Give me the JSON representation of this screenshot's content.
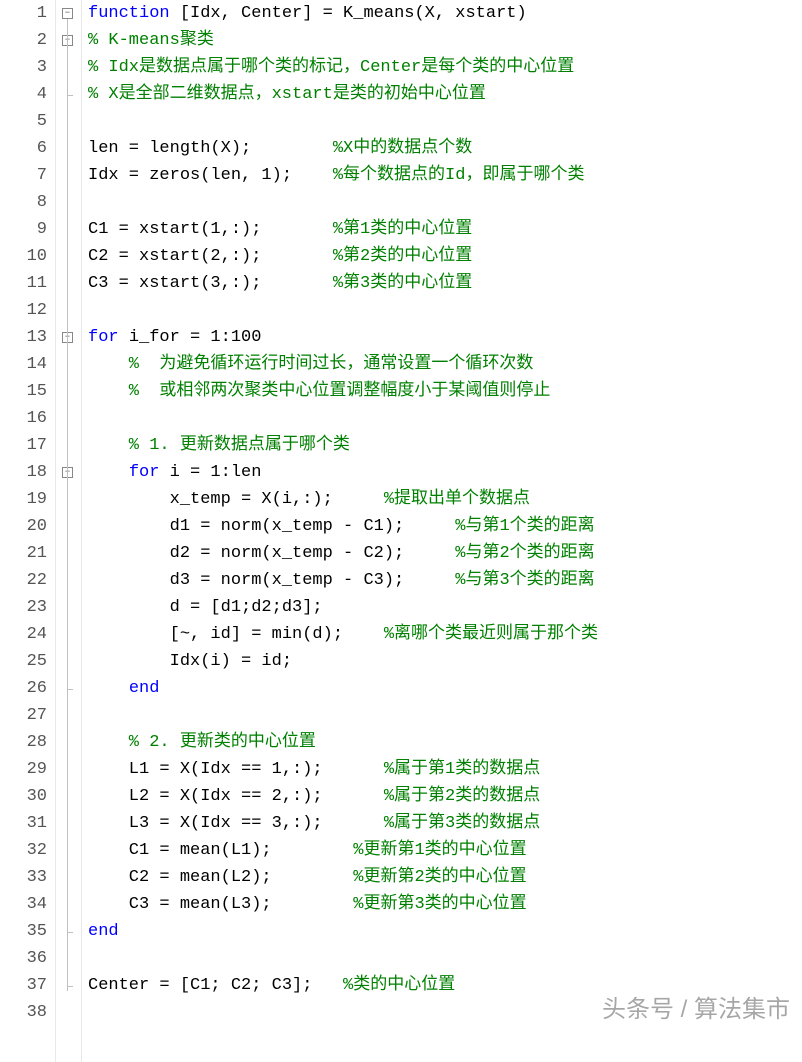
{
  "line_height": 27,
  "lines": [
    {
      "n": "1",
      "tokens": [
        {
          "c": "kw",
          "t": "function "
        },
        {
          "c": "txt",
          "t": "[Idx, Center] = K_means(X, xstart)"
        }
      ]
    },
    {
      "n": "2",
      "tokens": [
        {
          "c": "cm",
          "t": "% K-means聚类"
        }
      ]
    },
    {
      "n": "3",
      "tokens": [
        {
          "c": "cm",
          "t": "% Idx是数据点属于哪个类的标记，Center是每个类的中心位置"
        }
      ]
    },
    {
      "n": "4",
      "tokens": [
        {
          "c": "cm",
          "t": "% X是全部二维数据点，xstart是类的初始中心位置"
        }
      ]
    },
    {
      "n": "5",
      "tokens": []
    },
    {
      "n": "6",
      "tokens": [
        {
          "c": "txt",
          "t": "len = length(X);        "
        },
        {
          "c": "cm",
          "t": "%X中的数据点个数"
        }
      ]
    },
    {
      "n": "7",
      "tokens": [
        {
          "c": "txt",
          "t": "Idx = zeros(len, 1);    "
        },
        {
          "c": "cm",
          "t": "%每个数据点的Id，即属于哪个类"
        }
      ]
    },
    {
      "n": "8",
      "tokens": []
    },
    {
      "n": "9",
      "tokens": [
        {
          "c": "txt",
          "t": "C1 = xstart(1,:);       "
        },
        {
          "c": "cm",
          "t": "%第1类的中心位置"
        }
      ]
    },
    {
      "n": "10",
      "tokens": [
        {
          "c": "txt",
          "t": "C2 = xstart(2,:);       "
        },
        {
          "c": "cm",
          "t": "%第2类的中心位置"
        }
      ]
    },
    {
      "n": "11",
      "tokens": [
        {
          "c": "txt",
          "t": "C3 = xstart(3,:);       "
        },
        {
          "c": "cm",
          "t": "%第3类的中心位置"
        }
      ]
    },
    {
      "n": "12",
      "tokens": []
    },
    {
      "n": "13",
      "tokens": [
        {
          "c": "kw",
          "t": "for "
        },
        {
          "c": "txt",
          "t": "i_for = 1:100"
        }
      ]
    },
    {
      "n": "14",
      "tokens": [
        {
          "c": "cm",
          "t": "    %  为避免循环运行时间过长，通常设置一个循环次数"
        }
      ]
    },
    {
      "n": "15",
      "tokens": [
        {
          "c": "cm",
          "t": "    %  或相邻两次聚类中心位置调整幅度小于某阈值则停止"
        }
      ]
    },
    {
      "n": "16",
      "tokens": []
    },
    {
      "n": "17",
      "tokens": [
        {
          "c": "cm",
          "t": "    % 1. 更新数据点属于哪个类"
        }
      ]
    },
    {
      "n": "18",
      "tokens": [
        {
          "c": "txt",
          "t": "    "
        },
        {
          "c": "kw",
          "t": "for "
        },
        {
          "c": "txt",
          "t": "i = 1:len"
        }
      ]
    },
    {
      "n": "19",
      "tokens": [
        {
          "c": "txt",
          "t": "        x_temp = X(i,:);     "
        },
        {
          "c": "cm",
          "t": "%提取出单个数据点"
        }
      ]
    },
    {
      "n": "20",
      "tokens": [
        {
          "c": "txt",
          "t": "        d1 = norm(x_temp - C1);     "
        },
        {
          "c": "cm",
          "t": "%与第1个类的距离"
        }
      ]
    },
    {
      "n": "21",
      "tokens": [
        {
          "c": "txt",
          "t": "        d2 = norm(x_temp - C2);     "
        },
        {
          "c": "cm",
          "t": "%与第2个类的距离"
        }
      ]
    },
    {
      "n": "22",
      "tokens": [
        {
          "c": "txt",
          "t": "        d3 = norm(x_temp - C3);     "
        },
        {
          "c": "cm",
          "t": "%与第3个类的距离"
        }
      ]
    },
    {
      "n": "23",
      "tokens": [
        {
          "c": "txt",
          "t": "        d = [d1;d2;d3];"
        }
      ]
    },
    {
      "n": "24",
      "tokens": [
        {
          "c": "txt",
          "t": "        [~, id] = min(d);    "
        },
        {
          "c": "cm",
          "t": "%离哪个类最近则属于那个类"
        }
      ]
    },
    {
      "n": "25",
      "tokens": [
        {
          "c": "txt",
          "t": "        Idx(i) = id;"
        }
      ]
    },
    {
      "n": "26",
      "tokens": [
        {
          "c": "txt",
          "t": "    "
        },
        {
          "c": "kw",
          "t": "end"
        }
      ]
    },
    {
      "n": "27",
      "tokens": []
    },
    {
      "n": "28",
      "tokens": [
        {
          "c": "cm",
          "t": "    % 2. 更新类的中心位置"
        }
      ]
    },
    {
      "n": "29",
      "tokens": [
        {
          "c": "txt",
          "t": "    L1 = X(Idx == 1,:);      "
        },
        {
          "c": "cm",
          "t": "%属于第1类的数据点"
        }
      ]
    },
    {
      "n": "30",
      "tokens": [
        {
          "c": "txt",
          "t": "    L2 = X(Idx == 2,:);      "
        },
        {
          "c": "cm",
          "t": "%属于第2类的数据点"
        }
      ]
    },
    {
      "n": "31",
      "tokens": [
        {
          "c": "txt",
          "t": "    L3 = X(Idx == 3,:);      "
        },
        {
          "c": "cm",
          "t": "%属于第3类的数据点"
        }
      ]
    },
    {
      "n": "32",
      "tokens": [
        {
          "c": "txt",
          "t": "    C1 = mean(L1);        "
        },
        {
          "c": "cm",
          "t": "%更新第1类的中心位置"
        }
      ]
    },
    {
      "n": "33",
      "tokens": [
        {
          "c": "txt",
          "t": "    C2 = mean(L2);        "
        },
        {
          "c": "cm",
          "t": "%更新第2类的中心位置"
        }
      ]
    },
    {
      "n": "34",
      "tokens": [
        {
          "c": "txt",
          "t": "    C3 = mean(L3);        "
        },
        {
          "c": "cm",
          "t": "%更新第3类的中心位置"
        }
      ]
    },
    {
      "n": "35",
      "tokens": [
        {
          "c": "kw",
          "t": "end"
        }
      ]
    },
    {
      "n": "36",
      "tokens": []
    },
    {
      "n": "37",
      "tokens": [
        {
          "c": "txt",
          "t": "Center = [C1; C2; C3];   "
        },
        {
          "c": "cm",
          "t": "%类的中心位置"
        }
      ]
    },
    {
      "n": "38",
      "tokens": []
    }
  ],
  "fold_boxes": [
    {
      "line": 1,
      "sym": "−"
    },
    {
      "line": 2,
      "sym": "−"
    },
    {
      "line": 13,
      "sym": "−"
    },
    {
      "line": 18,
      "sym": "−"
    }
  ],
  "fold_ends": [
    4,
    26,
    35,
    37
  ],
  "watermark": "头条号 / 算法集市"
}
